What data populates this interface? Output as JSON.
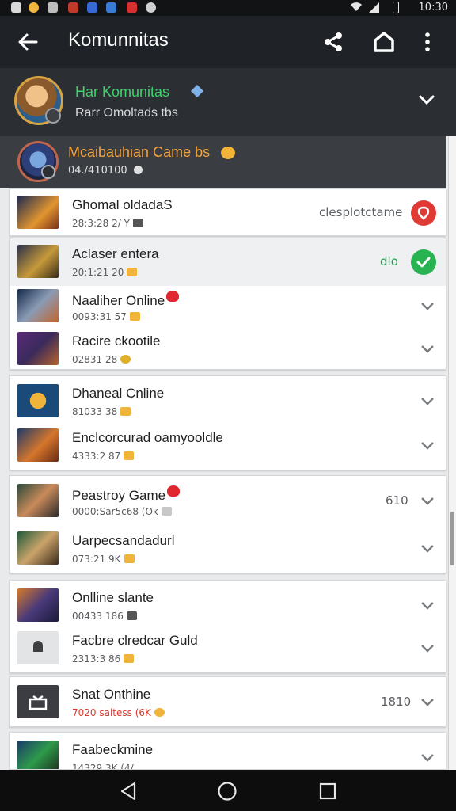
{
  "status_bar": {
    "time": "10:30"
  },
  "toolbar": {
    "title": "Komunnitas",
    "icons": [
      "back-arrow-icon",
      "share-icon",
      "home-icon",
      "more-vert-icon"
    ]
  },
  "community": {
    "name": "Har Komunitas",
    "subtitle": "Rarr Omoltads tbs"
  },
  "featured": {
    "name": "Mcaibauhian Came bs",
    "subtitle": "04./410100"
  },
  "colors": {
    "accent_green": "#27b352",
    "accent_red": "#df3b34",
    "header_bg": "#1f2226",
    "community_name": "#3bd46a",
    "featured_name": "#f2a23a"
  },
  "items": [
    {
      "title": "Ghomal oldadaS",
      "subtitle": "28:3:28 2/ Y",
      "meta": "clesplotctame",
      "status": "red"
    },
    {
      "title": "Aclaser entera",
      "subtitle": "20:1:21 20",
      "meta": "dlo",
      "status": "green"
    },
    {
      "title": "Naaliher Online",
      "subtitle": "0093:31 57"
    },
    {
      "title": "Racire ckootile",
      "subtitle": "02831 28"
    },
    {
      "title": "Dhaneal Cnline",
      "subtitle": "81033 38"
    },
    {
      "title": "Enclcorcurad oamyooldle",
      "subtitle": "4333:2 87"
    },
    {
      "title": "Peastroy Game",
      "subtitle": "0000:Sar5c68 (Ok",
      "meta": "610"
    },
    {
      "title": "Uarpecsandadurl",
      "subtitle": "073:21 9K"
    },
    {
      "title": "Onlline slante",
      "subtitle": "00433 186"
    },
    {
      "title": "Facbre clredcar Guld",
      "subtitle": "2313:3 86"
    },
    {
      "title": "Snat Onthine",
      "subtitle": "7020 saitess (6K",
      "meta": "1810"
    },
    {
      "title": "Faabeckmine",
      "subtitle": "14329 3K (4/"
    }
  ],
  "nav_bar": {
    "icons": [
      "nav-back-icon",
      "nav-home-icon",
      "nav-recents-icon"
    ]
  }
}
